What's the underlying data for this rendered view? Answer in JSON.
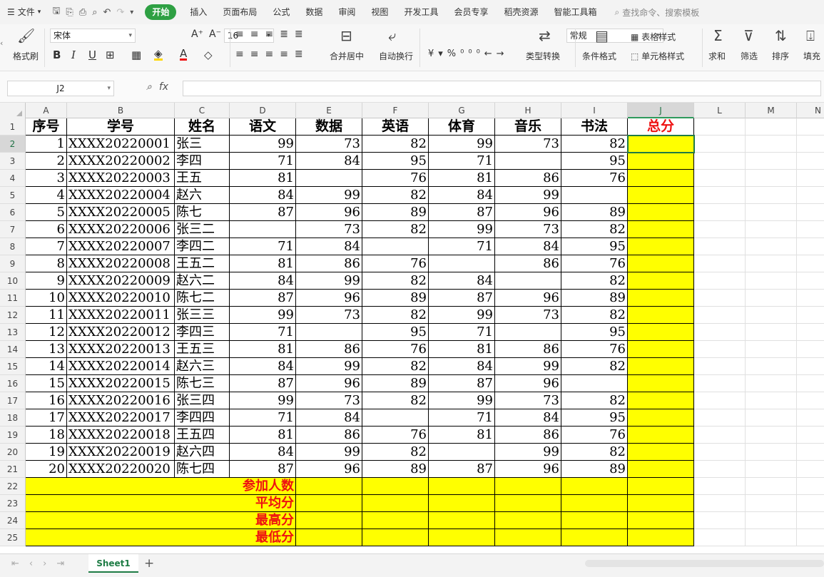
{
  "menubar": {
    "file": "文件",
    "tabs": [
      "开始",
      "插入",
      "页面布局",
      "公式",
      "数据",
      "审阅",
      "视图",
      "开发工具",
      "会员专享",
      "稻壳资源",
      "智能工具箱"
    ],
    "search_placeholder": "查找命令、搜索模板"
  },
  "ribbon": {
    "format_painter": "格式刷",
    "font": "宋体",
    "font_size": "16",
    "number_format": "常规",
    "merge": "合并居中",
    "wrap": "自动换行",
    "convert": "类型转换",
    "cond_format": "条件格式",
    "table_style": "表格样式",
    "cell_style": "单元格样式",
    "sum": "求和",
    "filter": "筛选",
    "sort": "排序",
    "fill": "填充"
  },
  "formula": {
    "cell_ref": "J2",
    "value": ""
  },
  "columns": [
    "A",
    "B",
    "C",
    "D",
    "E",
    "F",
    "G",
    "H",
    "I",
    "J",
    "L",
    "M",
    "N"
  ],
  "header_row": [
    "序号",
    "学号",
    "姓名",
    "语文",
    "数据",
    "英语",
    "体育",
    "音乐",
    "书法",
    "总分"
  ],
  "rows": [
    [
      "1",
      "XXXX20220001",
      "张三",
      "99",
      "73",
      "82",
      "99",
      "73",
      "82"
    ],
    [
      "2",
      "XXXX20220002",
      "李四",
      "71",
      "84",
      "95",
      "71",
      "",
      "95"
    ],
    [
      "3",
      "XXXX20220003",
      "王五",
      "81",
      "",
      "76",
      "81",
      "86",
      "76"
    ],
    [
      "4",
      "XXXX20220004",
      "赵六",
      "84",
      "99",
      "82",
      "84",
      "99",
      ""
    ],
    [
      "5",
      "XXXX20220005",
      "陈七",
      "87",
      "96",
      "89",
      "87",
      "96",
      "89"
    ],
    [
      "6",
      "XXXX20220006",
      "张三二",
      "",
      "73",
      "82",
      "99",
      "73",
      "82"
    ],
    [
      "7",
      "XXXX20220007",
      "李四二",
      "71",
      "84",
      "",
      "71",
      "84",
      "95"
    ],
    [
      "8",
      "XXXX20220008",
      "王五二",
      "81",
      "86",
      "76",
      "",
      "86",
      "76"
    ],
    [
      "9",
      "XXXX20220009",
      "赵六二",
      "84",
      "99",
      "82",
      "84",
      "",
      "82"
    ],
    [
      "10",
      "XXXX20220010",
      "陈七二",
      "87",
      "96",
      "89",
      "87",
      "96",
      "89"
    ],
    [
      "11",
      "XXXX20220011",
      "张三三",
      "99",
      "73",
      "82",
      "99",
      "73",
      "82"
    ],
    [
      "12",
      "XXXX20220012",
      "李四三",
      "71",
      "",
      "95",
      "71",
      "",
      "95"
    ],
    [
      "13",
      "XXXX20220013",
      "王五三",
      "81",
      "86",
      "76",
      "81",
      "86",
      "76"
    ],
    [
      "14",
      "XXXX20220014",
      "赵六三",
      "84",
      "99",
      "82",
      "84",
      "99",
      "82"
    ],
    [
      "15",
      "XXXX20220015",
      "陈七三",
      "87",
      "96",
      "89",
      "87",
      "96",
      ""
    ],
    [
      "16",
      "XXXX20220016",
      "张三四",
      "99",
      "73",
      "82",
      "99",
      "73",
      "82"
    ],
    [
      "17",
      "XXXX20220017",
      "李四四",
      "71",
      "84",
      "",
      "71",
      "84",
      "95"
    ],
    [
      "18",
      "XXXX20220018",
      "王五四",
      "81",
      "86",
      "76",
      "81",
      "86",
      "76"
    ],
    [
      "19",
      "XXXX20220019",
      "赵六四",
      "84",
      "99",
      "82",
      "",
      "99",
      "82"
    ],
    [
      "20",
      "XXXX20220020",
      "陈七四",
      "87",
      "96",
      "89",
      "87",
      "96",
      "89"
    ]
  ],
  "summary_labels": [
    "参加人数",
    "平均分",
    "最高分",
    "最低分"
  ],
  "sheet_tab": "Sheet1",
  "colors": {
    "accent": "#2ea043",
    "highlight": "#ffff00",
    "label_red": "#e11111"
  }
}
